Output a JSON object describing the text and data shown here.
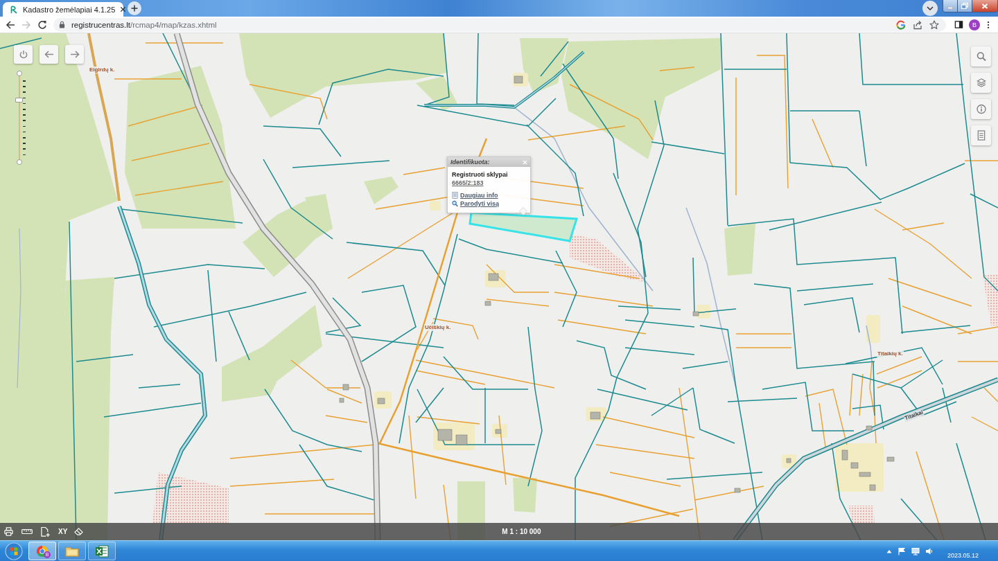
{
  "browser": {
    "tabs": [
      {
        "title": "Kadastro žemėlapiai 4.1.25",
        "selected": true
      }
    ],
    "nav": [
      {
        "kind": "back",
        "disabled": false
      },
      {
        "kind": "forward",
        "disabled": true
      },
      {
        "kind": "reload",
        "disabled": false
      }
    ],
    "address": {
      "host": "registrucentras.lt",
      "path": "/rcmap4/map/kzas.xhtml"
    },
    "profile": {
      "initial": "B"
    }
  },
  "map": {
    "place_labels": [
      {
        "text": "Eigirdų k.",
        "kind": "village"
      },
      {
        "text": "Učiškių k.",
        "kind": "village"
      },
      {
        "text": "Titaikių k.",
        "kind": "village"
      },
      {
        "text": "Titaikai",
        "kind": "road"
      }
    ],
    "zoom_slider": {
      "level": 0.7
    },
    "popup": {
      "title": "Identifikuota:",
      "heading": "Registruoti sklypai",
      "parcel_id": "6665/2:183",
      "links": [
        {
          "label": "Daugiau info",
          "kind": "info"
        },
        {
          "label": "Parodyti visą",
          "kind": "zoom"
        }
      ]
    },
    "bottom_toolbar": {
      "coordinates_label": "XY",
      "scale": "M 1 : 10 000"
    }
  },
  "taskbar": {
    "apps": [
      {
        "kind": "chrome",
        "selected": true,
        "badge": "B"
      },
      {
        "kind": "explorer",
        "selected": false
      },
      {
        "kind": "excel",
        "selected": false
      }
    ],
    "date": "2023.05.12"
  }
}
